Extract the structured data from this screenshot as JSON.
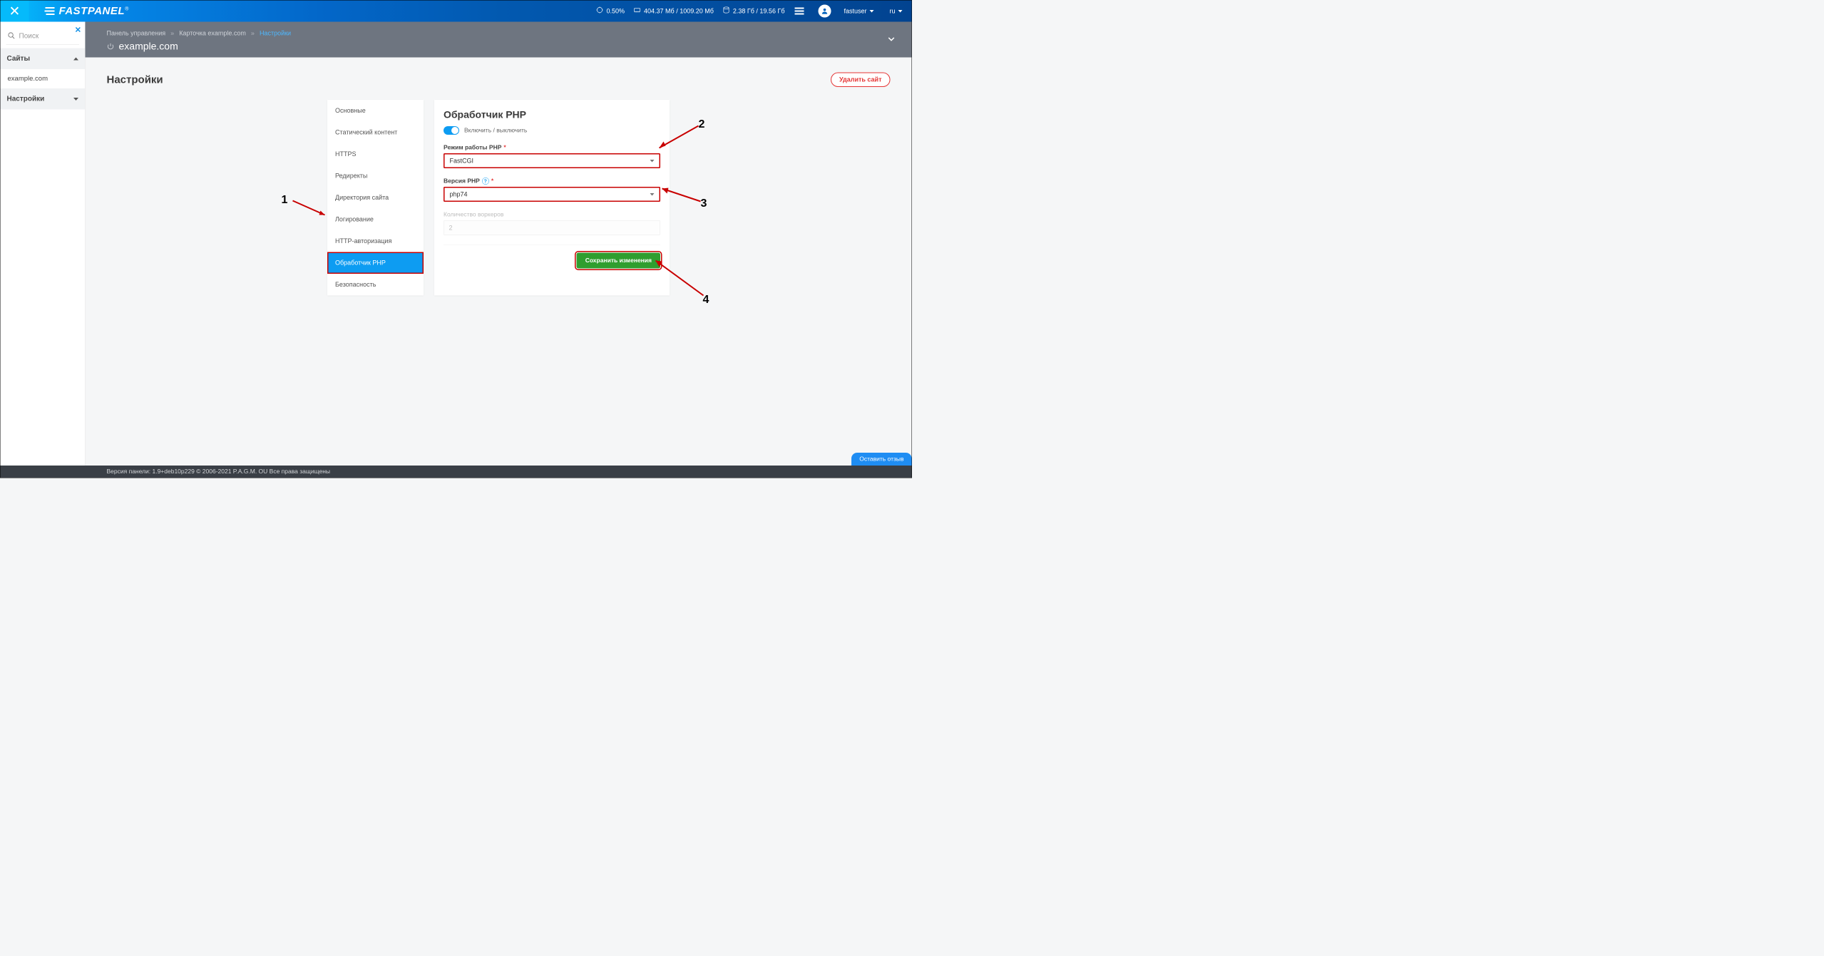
{
  "header": {
    "logo": "FASTPANEL",
    "logo_reg": "®",
    "cpu": "0.50%",
    "ram": "404.37 Мб / 1009.20 Мб",
    "disk": "2.38 Гб / 19.56 Гб",
    "user": "fastuser",
    "lang": "ru"
  },
  "sidebar": {
    "search_placeholder": "Поиск",
    "groups": {
      "sites": {
        "label": "Сайты",
        "items": [
          "example.com"
        ]
      },
      "settings": {
        "label": "Настройки"
      }
    }
  },
  "breadcrumb": {
    "items": [
      "Панель управления",
      "Карточка example.com",
      "Настройки"
    ],
    "site": "example.com"
  },
  "page": {
    "title": "Настройки",
    "delete_label": "Удалить сайт"
  },
  "tabs": [
    "Основные",
    "Статический контент",
    "HTTPS",
    "Редиректы",
    "Директория сайта",
    "Логирование",
    "HTTP-авторизация",
    "Обработчик PHP",
    "Безопасность"
  ],
  "active_tab_index": 7,
  "form": {
    "title": "Обработчик PHP",
    "toggle_label": "Включить / выключить",
    "mode_label": "Режим работы PHP",
    "mode_value": "FastCGI",
    "version_label": "Версия PHP",
    "version_value": "php74",
    "workers_label": "Количество воркеров",
    "workers_value": "2",
    "save_label": "Сохранить изменения"
  },
  "annotations": {
    "n1": "1",
    "n2": "2",
    "n3": "3",
    "n4": "4"
  },
  "footer": {
    "text": "Версия панели: 1.9+deb10p229 © 2006-2021 P.A.G.M. OU Все права защищены",
    "feedback": "Оставить отзыв"
  }
}
